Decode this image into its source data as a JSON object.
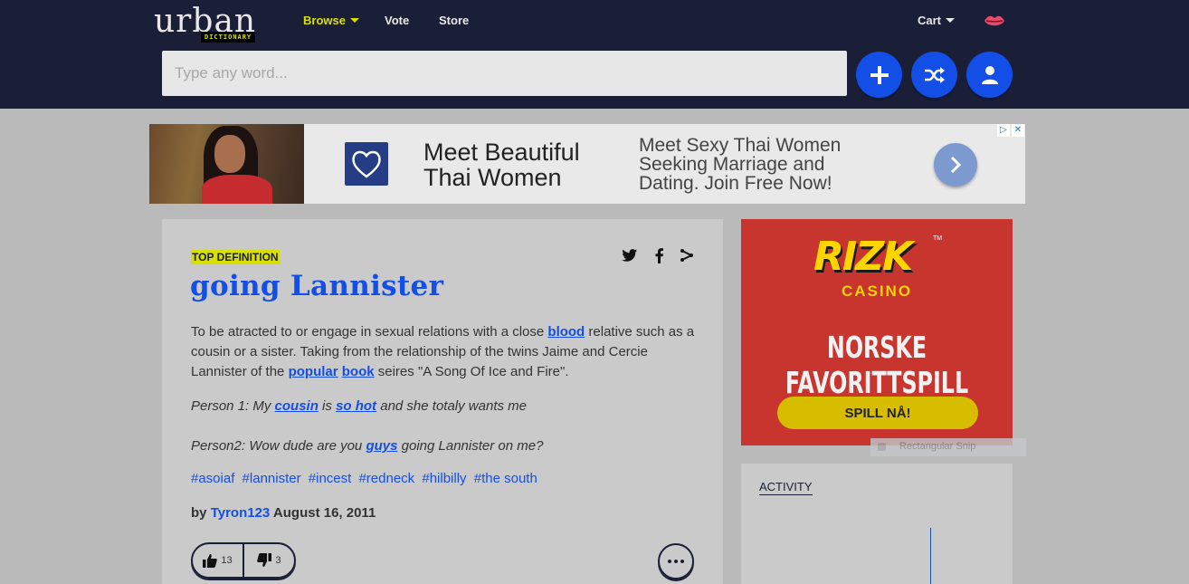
{
  "header": {
    "logo_word": "urban",
    "logo_sub": "DICTIONARY",
    "nav": {
      "browse": "Browse",
      "vote": "Vote",
      "store": "Store",
      "cart": "Cart"
    },
    "search_placeholder": "Type any word..."
  },
  "ad_banner": {
    "headline": "Meet Beautiful Thai Women",
    "text": "Meet Sexy Thai Women Seeking Marriage and Dating. Join Free Now!",
    "choices": [
      "▷",
      "✕"
    ]
  },
  "definition": {
    "tag": "TOP DEFINITION",
    "word": "going Lannister",
    "meaning_parts": {
      "p1": "To be atracted to or engage in sexual relations with a close ",
      "l1": "blood",
      "p2": " relative such as a cousin or a sister. Taking from the relationship of the twins Jaime and Cercie Lannister of the ",
      "l2": "popular",
      "p3": " ",
      "l3": "book",
      "p4": " seires \"A Song Of Ice and Fire\"."
    },
    "example1": {
      "p1": "Person 1: My ",
      "l1": "cousin",
      "p2": " is ",
      "l2": "so hot",
      "p3": " and she totaly wants me"
    },
    "example2": {
      "p1": "Person2: Wow dude are you ",
      "l1": "guys",
      "p2": " going Lannister on me?"
    },
    "tags": [
      "#asoiaf",
      "#lannister",
      "#incest",
      "#redneck",
      "#hilbilly",
      "#the south"
    ],
    "byline": {
      "by": "by",
      "author": "Tyron123",
      "date": "August 16, 2011"
    },
    "votes": {
      "up": "13",
      "down": "3"
    }
  },
  "side_ad": {
    "brand": "RIZK",
    "tm": "TM",
    "casino": "CASINO",
    "headline": "NORSKE FAVORITTSPILL",
    "button": "SPILL NÅ!"
  },
  "snip_tooltip": "Rectangular Snip",
  "activity": {
    "title": "ACTIVITY"
  },
  "colors": {
    "header_bg": "#1a1e36",
    "accent_yellow": "#d8e000",
    "link_blue": "#134fe6",
    "page_bg": "#bababa",
    "ad_red": "#c7352e"
  }
}
